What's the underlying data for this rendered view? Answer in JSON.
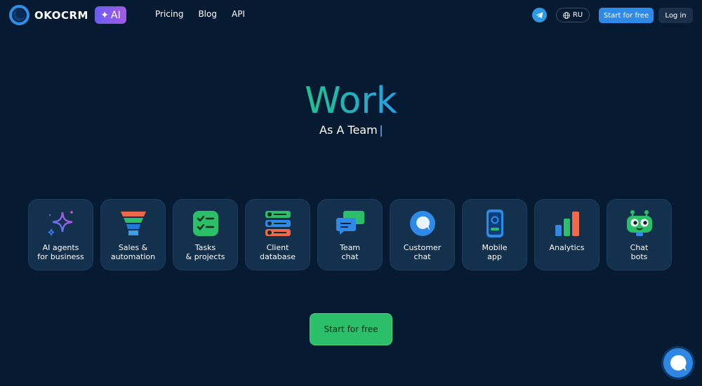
{
  "brand": {
    "name": "OKOCRM",
    "ai_badge": "AI"
  },
  "nav": {
    "items": [
      "Pricing",
      "Blog",
      "API"
    ]
  },
  "header": {
    "lang": "RU",
    "start_label": "Start for free",
    "login_label": "Log in"
  },
  "hero": {
    "title": "Work",
    "subtitle": "As A Team"
  },
  "features": [
    {
      "label": "AI agents\nfor business",
      "icon": "sparkles-icon"
    },
    {
      "label": "Sales &\nautomation",
      "icon": "funnel-icon"
    },
    {
      "label": "Tasks\n& projects",
      "icon": "checklist-icon"
    },
    {
      "label": "Client\ndatabase",
      "icon": "contacts-icon"
    },
    {
      "label": "Team\nchat",
      "icon": "team-chat-icon"
    },
    {
      "label": "Customer\nchat",
      "icon": "customer-chat-icon"
    },
    {
      "label": "Mobile\napp",
      "icon": "mobile-icon"
    },
    {
      "label": "Analytics",
      "icon": "bar-chart-icon"
    },
    {
      "label": "Chat\nbots",
      "icon": "robot-icon"
    }
  ],
  "cta": {
    "label": "Start for free"
  },
  "colors": {
    "background": "#061a31",
    "accent_blue": "#2e8ae6",
    "accent_green": "#2bbf6a",
    "card": "#13304d"
  }
}
